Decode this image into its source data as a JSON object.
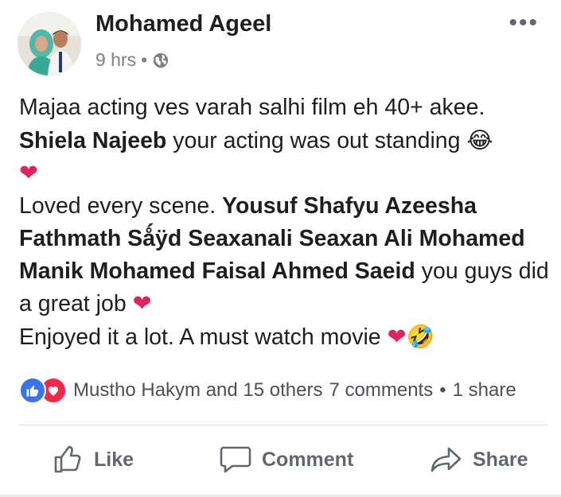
{
  "post": {
    "author": "Mohamed Ageel",
    "time": "9 hrs",
    "separator": "•",
    "privacy_icon": "globe-icon",
    "more_label": "•••",
    "text": {
      "line1": "Majaa acting ves varah salhi film eh 40+ akee.",
      "mention1": "Shiela Najeeb",
      "line2_rest": " your acting was out standing ",
      "emoji_laugh": "😂",
      "heart": "❤",
      "line3_start": "Loved every scene. ",
      "mentions2": "Yousuf Shafyu Azeesha Fathmath Sǻÿd Seaxanali Seaxan Ali Mohamed Manik Mohamed Faisal Ahmed Saeid",
      "line3_rest": " you guys did a great job ",
      "line4": "Enjoyed it a lot. A must watch movie ",
      "emoji_rofl": "🤣"
    },
    "reactions": {
      "summary": "Mustho Hakym and 15 others",
      "comments": "7 comments",
      "dot": "•",
      "shares": "1 share"
    },
    "actions": {
      "like": "Like",
      "comment": "Comment",
      "share": "Share"
    }
  },
  "colors": {
    "text": "#1c1e21",
    "muted": "#7b7f86",
    "like_blue": "#3b73e8",
    "love_red": "#f0284a",
    "heart": "#e0245e"
  }
}
